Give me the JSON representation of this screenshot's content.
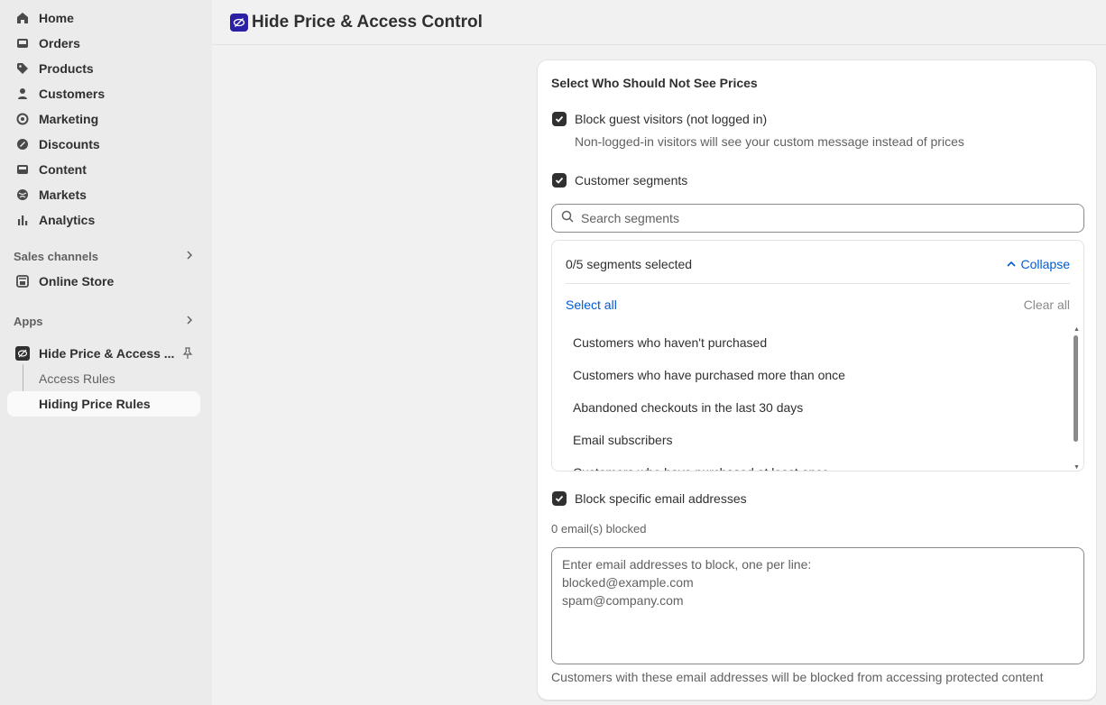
{
  "sidebar": {
    "nav": [
      {
        "label": "Home",
        "icon": "home-icon"
      },
      {
        "label": "Orders",
        "icon": "inbox-icon"
      },
      {
        "label": "Products",
        "icon": "tag-icon"
      },
      {
        "label": "Customers",
        "icon": "person-icon"
      },
      {
        "label": "Marketing",
        "icon": "target-icon"
      },
      {
        "label": "Discounts",
        "icon": "discount-icon"
      },
      {
        "label": "Content",
        "icon": "image-icon"
      },
      {
        "label": "Markets",
        "icon": "globe-icon"
      },
      {
        "label": "Analytics",
        "icon": "bar-chart-icon"
      }
    ],
    "sales_channels": {
      "label": "Sales channels",
      "items": [
        {
          "label": "Online Store",
          "icon": "store-icon"
        }
      ]
    },
    "apps": {
      "label": "Apps",
      "app": {
        "label": "Hide Price & Access ...",
        "icon": "eye-off-icon"
      },
      "subitems": [
        {
          "label": "Access Rules",
          "active": false
        },
        {
          "label": "Hiding Price Rules",
          "active": true
        }
      ]
    }
  },
  "header": {
    "title": "Hide Price & Access Control",
    "logo_color": "#2b1fa6"
  },
  "card": {
    "title": "Select Who Should Not See Prices",
    "guest": {
      "label": "Block guest visitors (not logged in)",
      "checked": true,
      "help": "Non-logged-in visitors will see your custom message instead of prices"
    },
    "segments": {
      "label": "Customer segments",
      "checked": true,
      "search_placeholder": "Search segments",
      "count_text": "0/5 segments selected",
      "collapse_label": "Collapse",
      "select_all_label": "Select all",
      "clear_all_label": "Clear all",
      "items": [
        "Customers who haven't purchased",
        "Customers who have purchased more than once",
        "Abandoned checkouts in the last 30 days",
        "Email subscribers",
        "Customers who have purchased at least once"
      ]
    },
    "emails": {
      "label": "Block specific email addresses",
      "checked": true,
      "count_text": "0 email(s) blocked",
      "placeholder": "Enter email addresses to block, one per line:\nblocked@example.com\nspam@company.com",
      "help": "Customers with these email addresses will be blocked from accessing protected content"
    }
  },
  "colors": {
    "accent_link": "#005bd3",
    "checkbox": "#303030"
  }
}
